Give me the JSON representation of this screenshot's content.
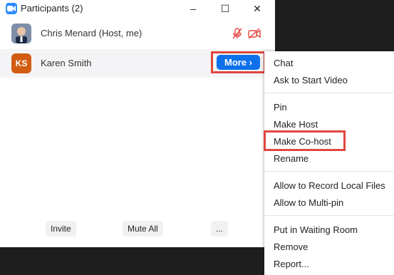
{
  "window": {
    "title": "Participants (2)",
    "controls": [
      "–",
      "☐",
      "✕"
    ]
  },
  "participants": [
    {
      "name": "Chris Menard (Host, me)",
      "avatar": "photo",
      "mic": "muted",
      "video": "off"
    },
    {
      "name": "Karen Smith",
      "initials": "KS",
      "avatar_color": "#d25d12",
      "more_label": "More ›"
    }
  ],
  "footer": {
    "invite": "Invite",
    "mute_all": "Mute All",
    "more": "..."
  },
  "context_menu": {
    "items": [
      "Chat",
      "Ask to Start Video",
      "Pin",
      "Make Host",
      "Make Co-host",
      "Rename",
      "Allow to Record Local Files",
      "Allow to Multi-pin",
      "Put in Waiting Room",
      "Remove",
      "Report..."
    ],
    "highlighted": "Make Co-host"
  },
  "colors": {
    "accent": "#0e71eb",
    "highlight": "#e0463f",
    "muted_icon": "#e0463f"
  }
}
